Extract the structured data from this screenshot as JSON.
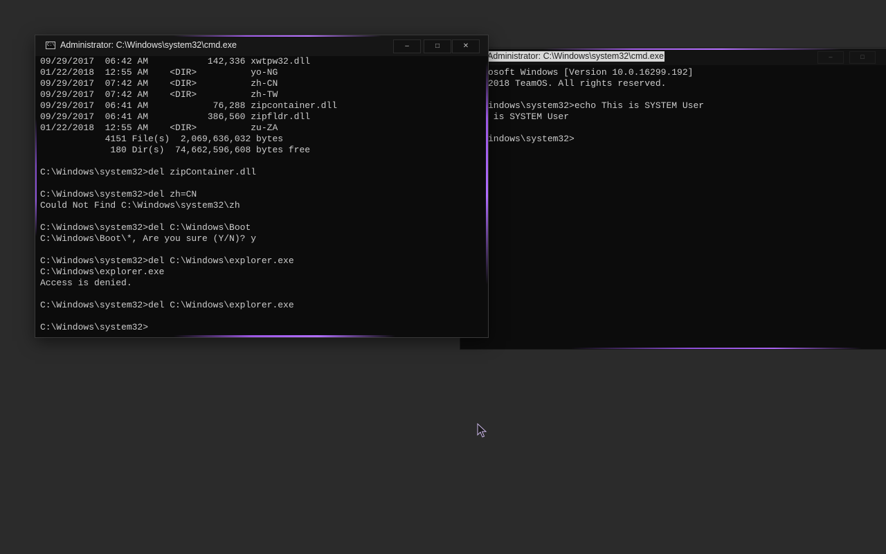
{
  "colors": {
    "desktop": "#2b2b2b",
    "console_bg": "#0c0c0c",
    "console_text": "#cccccc",
    "accent_glow": "#b06dff"
  },
  "back_window": {
    "title": "Administrator: C:\\Windows\\system32\\cmd.exe",
    "controls": {
      "minimize": "–",
      "maximize": "□"
    },
    "lines": [
      "osoft Windows [Version 10.0.16299.192]",
      "2018 TeamOS. All rights reserved.",
      "",
      "indows\\system32>echo This is SYSTEM User",
      " is SYSTEM User",
      "",
      "indows\\system32>"
    ]
  },
  "front_window": {
    "icon": "cmd-icon",
    "icon_glyph": "C:\\",
    "title": "Administrator: C:\\Windows\\system32\\cmd.exe",
    "controls": {
      "minimize": "–",
      "maximize": "□",
      "close": "✕"
    },
    "lines": [
      "09/29/2017  06:42 AM           142,336 xwtpw32.dll",
      "01/22/2018  12:55 AM    <DIR>          yo-NG",
      "09/29/2017  07:42 AM    <DIR>          zh-CN",
      "09/29/2017  07:42 AM    <DIR>          zh-TW",
      "09/29/2017  06:41 AM            76,288 zipcontainer.dll",
      "09/29/2017  06:41 AM           386,560 zipfldr.dll",
      "01/22/2018  12:55 AM    <DIR>          zu-ZA",
      "            4151 File(s)  2,069,636,032 bytes",
      "             180 Dir(s)  74,662,596,608 bytes free",
      "",
      "C:\\Windows\\system32>del zipContainer.dll",
      "",
      "C:\\Windows\\system32>del zh=CN",
      "Could Not Find C:\\Windows\\system32\\zh",
      "",
      "C:\\Windows\\system32>del C:\\Windows\\Boot",
      "C:\\Windows\\Boot\\*, Are you sure (Y/N)? y",
      "",
      "C:\\Windows\\system32>del C:\\Windows\\explorer.exe",
      "C:\\Windows\\explorer.exe",
      "Access is denied.",
      "",
      "C:\\Windows\\system32>del C:\\Windows\\explorer.exe",
      "",
      "C:\\Windows\\system32>"
    ]
  },
  "cursor": {
    "icon": "mouse-pointer-icon"
  }
}
